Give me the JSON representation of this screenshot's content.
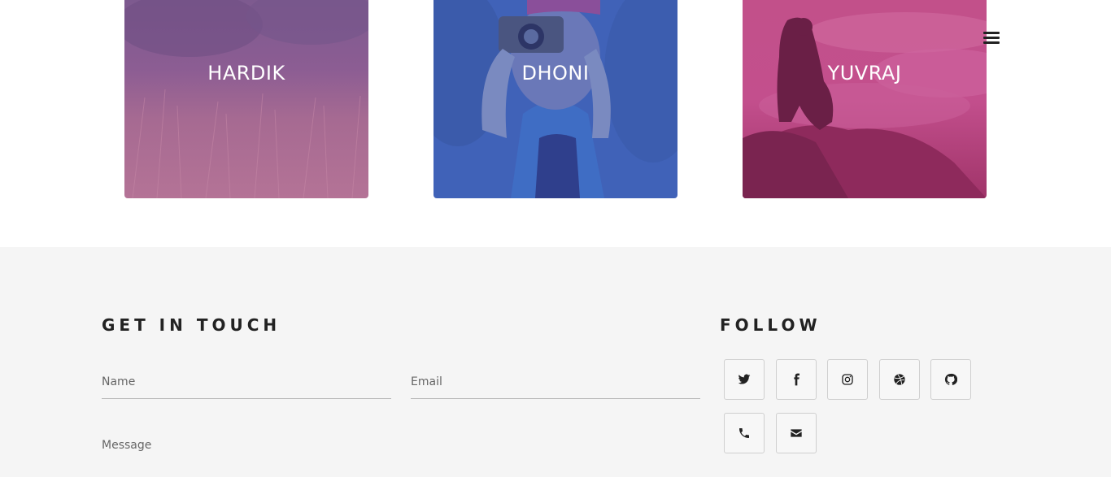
{
  "team": [
    {
      "name": "HARDIK"
    },
    {
      "name": "DHONI"
    },
    {
      "name": "YUVRAJ"
    }
  ],
  "nav": {
    "menu_icon": "hamburger-icon"
  },
  "contact": {
    "heading": "GET IN TOUCH",
    "name_placeholder": "Name",
    "email_placeholder": "Email",
    "message_placeholder": "Message"
  },
  "follow": {
    "heading": "FOLLOW",
    "links": [
      "twitter-icon",
      "facebook-icon",
      "instagram-icon",
      "dribbble-icon",
      "github-icon",
      "phone-icon",
      "envelope-icon"
    ]
  },
  "colors": {
    "footer_bg": "#f5f5f5",
    "card_purple": "#8e5aa0",
    "card_blue": "#3f66c2",
    "card_magenta": "#a8386f"
  }
}
